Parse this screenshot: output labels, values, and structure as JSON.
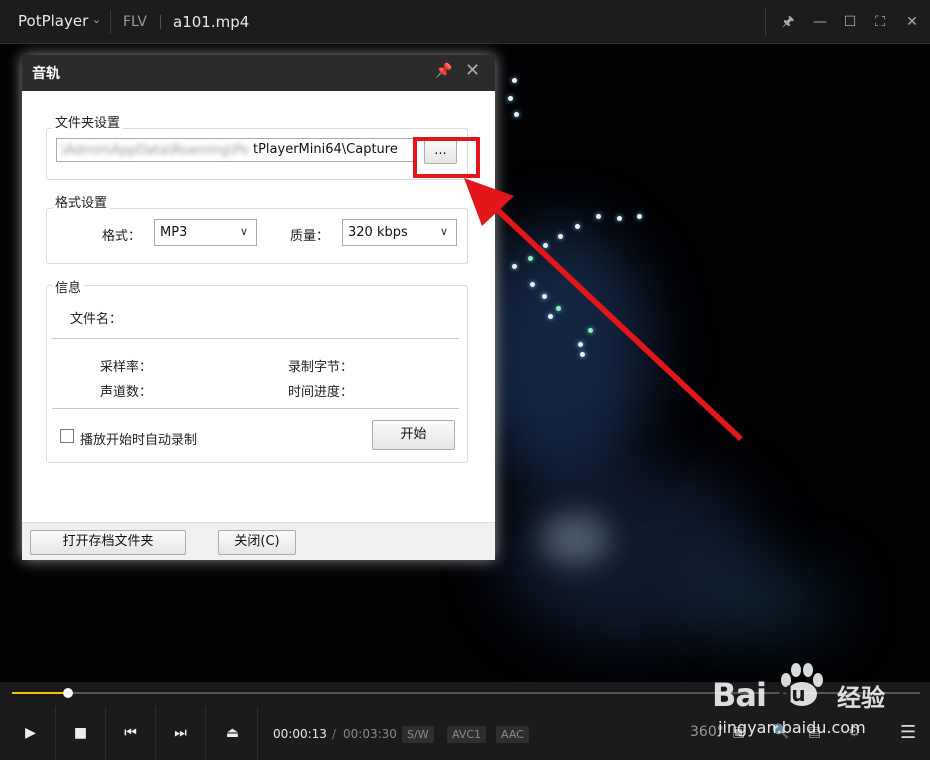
{
  "titlebar": {
    "app_name": "PotPlayer",
    "app_caret": "⌄",
    "format": "FLV",
    "filename": "a101.mp4",
    "buttons": {
      "pin": "🖈",
      "minimize": "—",
      "maximize": "☐",
      "fullscreen": "⛶",
      "close": "✕"
    }
  },
  "dialog": {
    "title": "音轨",
    "folder_group": {
      "title": "文件夹设置",
      "path_blurred": "\\Admin\\AppData\\Roaming\\Po",
      "path_visible": "tPlayerMini64\\Capture",
      "browse_label": "..."
    },
    "format_group": {
      "title": "格式设置",
      "format_label": "格式：",
      "format_value": "MP3",
      "quality_label": "质量：",
      "quality_value": "320 kbps"
    },
    "info_group": {
      "title": "信息",
      "filename_label": "文件名：",
      "sample_rate_label": "采样率：",
      "channels_label": "声道数：",
      "recorded_bytes_label": "录制字节：",
      "time_progress_label": "时间进度：",
      "auto_record_label": "播放开始时自动录制",
      "start_label": "开始"
    },
    "footer": {
      "open_folder_label": "打开存档文件夹",
      "close_label": "关闭(C)"
    }
  },
  "controls": {
    "current_time": "00:00:13",
    "separator": "/",
    "total_time": "00:03:30",
    "tags": [
      "S/W",
      "AVC1",
      "AAC"
    ],
    "progress": 0.062
  },
  "watermark": {
    "brand": "Bai",
    "brand_suffix": "du",
    "product": "经验",
    "url": "jingyan.baidu.com"
  },
  "colors": {
    "highlight": "#e3161a",
    "seek_fill": "#f3c300"
  }
}
